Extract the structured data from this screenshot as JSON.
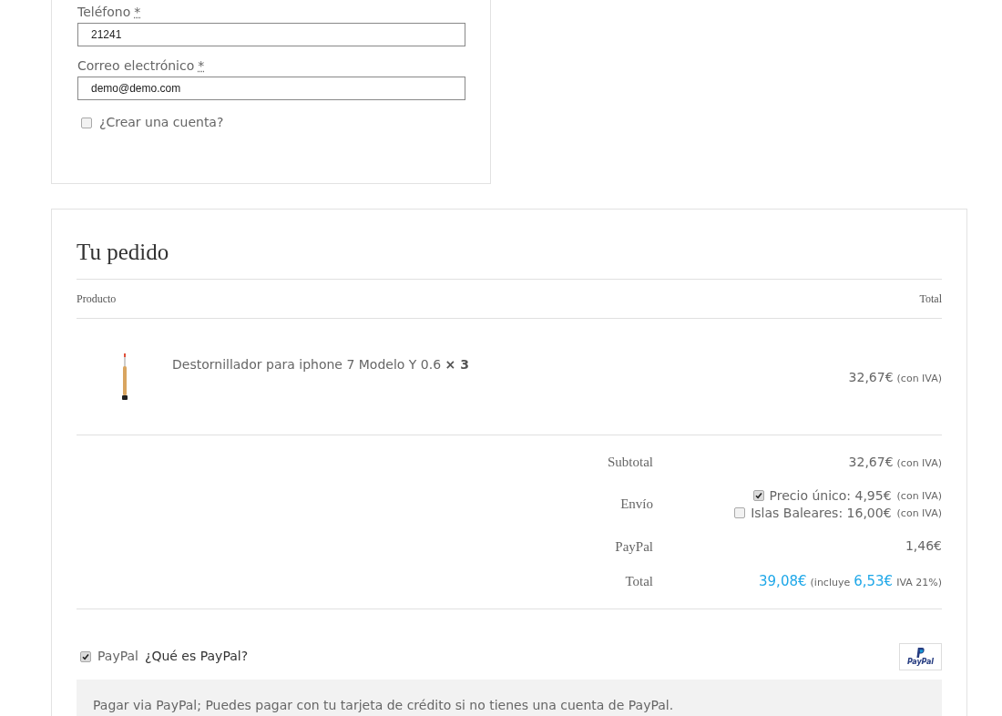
{
  "contact_fields": [
    {
      "label": "Teléfono",
      "required_mark": "*",
      "value": "21241"
    },
    {
      "label": "Correo electrónico",
      "required_mark": "*",
      "value": "demo@demo.com"
    }
  ],
  "create_account": {
    "label": "¿Crear una cuenta?",
    "checked": false
  },
  "order": {
    "title": "Tu pedido",
    "columns": [
      "Producto",
      "Total"
    ],
    "items": [
      {
        "name": "Destornillador para iphone 7 Modelo Y 0.6",
        "quantity": "× 3",
        "price": "32,67€",
        "tax_note": "(con IVA)"
      }
    ],
    "subtotal": {
      "label": "Subtotal",
      "amount": "32,67€",
      "tax_note": "(con IVA)"
    },
    "shipping": {
      "label": "Envío",
      "options": [
        {
          "label": "Precio único: 4,95€",
          "tax_note": "(con IVA)",
          "checked": true
        },
        {
          "label": "Islas Baleares: 16,00€",
          "tax_note": "(con IVA)",
          "checked": false
        }
      ]
    },
    "fee": {
      "label": "PayPal",
      "amount": "1,46€"
    },
    "total": {
      "label": "Total",
      "amount": "39,08€",
      "includes": "(incluye",
      "tax_amount": "6,53€",
      "tax_rate": "IVA 21%)"
    }
  },
  "payment": {
    "method": "PayPal",
    "link": "¿Qué es PayPal?",
    "checked": true,
    "logo_text": "PayPal",
    "description": "Pagar via PayPal; Puedes pagar con tu tarjeta de crédito si no tienes una cuenta de PayPal."
  }
}
